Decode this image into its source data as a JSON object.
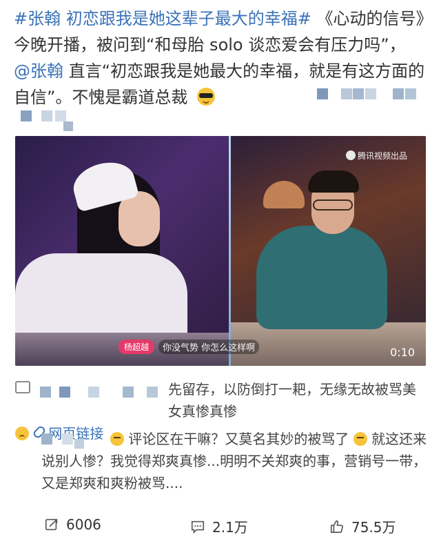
{
  "post": {
    "hashtag": "#张翰 初恋跟我是她这辈子最大的幸福#",
    "text_part1": "《心动的信号》今晚开播，被问到“和母胎 solo 谈恋爱会有压力吗”，",
    "mention": "@张翰",
    "text_part2": " 直言“初恋跟我是她最大的幸福，就是有这方面的自信”。不愧是霸道总裁"
  },
  "video": {
    "watermark": "腾讯视频出品",
    "speaker": "杨超越",
    "subtitle": "你没气势 你怎么这样啊",
    "duration": "0:10"
  },
  "repost": {
    "text_part1": "先留存，以防倒打一耙，无缘无故被骂美女真惨真惨",
    "link_label": "网页链接"
  },
  "comment": {
    "text_part1": "评论区在干嘛？又莫名其妙的被骂了",
    "text_part2": "就这还来说别人惨？我觉得郑爽真惨...明明不关郑爽的事，营销号一带，又是郑爽和爽粉被骂...."
  },
  "stats": {
    "reposts": "6006",
    "comments": "2.1万",
    "likes": "75.5万"
  },
  "icons": {
    "repost": "share-icon",
    "comment": "comment-icon",
    "like": "thumbs-up-icon"
  }
}
